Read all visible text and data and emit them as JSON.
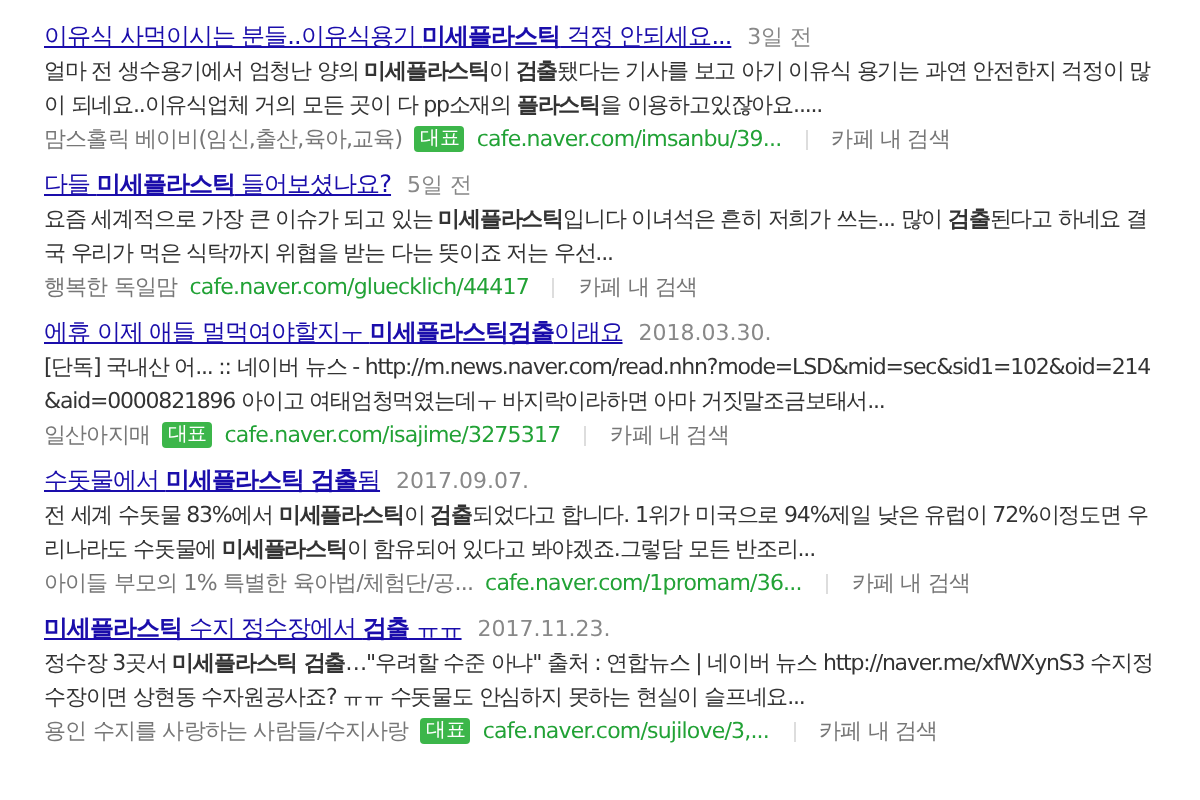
{
  "results": [
    {
      "title": "이유식 사먹이시는 분들..이유식용기 **미세플라스틱** 걱정 안되세요...",
      "date": "3일 전",
      "snippet": "얼마 전 생수용기에서 엄청난 양의 **미세플라스틱**이 **검출**됐다는 기사를 보고 아기 이유식 용기는 과연 안전한지 걱정이 많이 되네요..이유식업체 거의 모든 곳이 다 pp소재의 **플라스틱**을 이용하고있잖아요.....",
      "cafe": "맘스홀릭 베이비(임신,출산,육아,교육)",
      "badge": "대표",
      "url": "cafe.naver.com/imsanbu/39...",
      "action": "카페 내 검색"
    },
    {
      "title": "다들 **미세플라스틱** 들어보셨나요?",
      "date": "5일 전",
      "snippet": "요즘 세계적으로 가장 큰 이슈가 되고 있는 **미세플라스틱**입니다 이녀석은 흔히 저희가 쓰는... 많이 **검출**된다고 하네요 결국 우리가 먹은 식탁까지 위협을 받는 다는 뜻이죠 저는 우선...",
      "cafe": "행복한 독일맘",
      "url": "cafe.naver.com/gluecklich/44417",
      "action": "카페 내 검색"
    },
    {
      "title": "에휴 이제 애들 멀먹여야할지ㅜ **미세플라스틱검출**이래요",
      "date": "2018.03.30.",
      "snippet": "[단독] 국내산 어... :: 네이버 뉴스 - http://m.news.naver.com/read.nhn?mode=LSD&mid=sec&sid1=102&oid=214&aid=0000821896 아이고 여태엄청먹였는데ㅜ 바지락이라하면 아마 거짓말조금보태서...",
      "cafe": "일산아지매",
      "badge": "대표",
      "url": "cafe.naver.com/isajime/3275317",
      "action": "카페 내 검색"
    },
    {
      "title": "수돗물에서 **미세플라스틱 검출**됨",
      "date": "2017.09.07.",
      "snippet": "전 세계 수돗물 83%에서 **미세플라스틱**이 **검출**되었다고 합니다. 1위가 미국으로 94%제일 낮은 유럽이 72%이정도면 우리나라도 수돗물에 **미세플라스틱**이 함유되어 있다고 봐야겠죠.그렇담 모든 반조리...",
      "cafe": "아이들 부모의 1% 특별한 육아법/체험단/공...",
      "url": "cafe.naver.com/1promam/36...",
      "action": "카페 내 검색"
    },
    {
      "title": "**미세플라스틱** 수지 정수장에서 **검출** ㅠㅠ",
      "date": "2017.11.23.",
      "snippet": "정수장 3곳서 **미세플라스틱 검출**…\"우려할 수준 아냐\" 출처 : 연합뉴스 | 네이버 뉴스 http://naver.me/xfWXynS3 수지정수장이면 상현동 수자원공사죠? ㅠㅠ 수돗물도 안심하지 못하는 현실이 슬프네요...",
      "cafe": "용인 수지를 사랑하는 사람들/수지사랑",
      "badge": "대표",
      "url": "cafe.naver.com/sujilove/3,...",
      "action": "카페 내 검색"
    }
  ]
}
